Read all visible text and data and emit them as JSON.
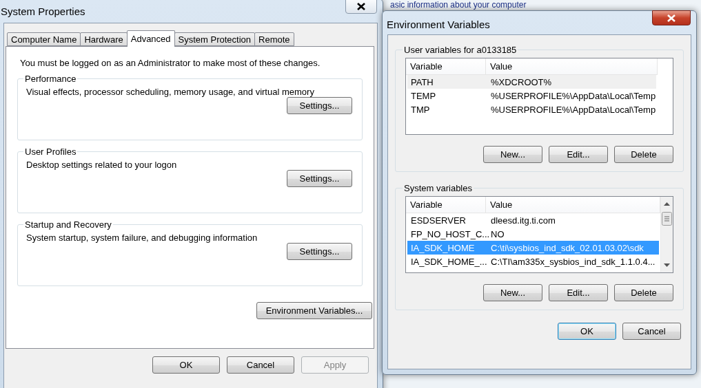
{
  "background": {
    "heading": "asic information about your computer"
  },
  "system_properties": {
    "title": "System Properties",
    "tabs": [
      {
        "label": "Computer Name",
        "selected": false
      },
      {
        "label": "Hardware",
        "selected": false
      },
      {
        "label": "Advanced",
        "selected": true
      },
      {
        "label": "System Protection",
        "selected": false
      },
      {
        "label": "Remote",
        "selected": false
      }
    ],
    "notice": "You must be logged on as an Administrator to make most of these changes.",
    "groups": [
      {
        "title": "Performance",
        "description": "Visual effects, processor scheduling, memory usage, and virtual memory",
        "button": "Settings..."
      },
      {
        "title": "User Profiles",
        "description": "Desktop settings related to your logon",
        "button": "Settings..."
      },
      {
        "title": "Startup and Recovery",
        "description": "System startup, system failure, and debugging information",
        "button": "Settings..."
      }
    ],
    "env_button": "Environment Variables...",
    "buttons": [
      {
        "label": "OK",
        "disabled": false
      },
      {
        "label": "Cancel",
        "disabled": false
      },
      {
        "label": "Apply",
        "disabled": true
      }
    ]
  },
  "environment_variables": {
    "title": "Environment Variables",
    "lists": [
      {
        "title": "User variables for a0133185",
        "focused": false,
        "columns": [
          "Variable",
          "Value"
        ],
        "rows": [
          {
            "variable": "PATH",
            "value": "%XDCROOT%",
            "selected": true
          },
          {
            "variable": "TEMP",
            "value": "%USERPROFILE%\\AppData\\Local\\Temp",
            "selected": false
          },
          {
            "variable": "TMP",
            "value": "%USERPROFILE%\\AppData\\Local\\Temp",
            "selected": false
          }
        ],
        "buttons": [
          "New...",
          "Edit...",
          "Delete"
        ]
      },
      {
        "title": "System variables",
        "focused": true,
        "columns": [
          "Variable",
          "Value"
        ],
        "rows": [
          {
            "variable": "ESDSERVER",
            "value": "dleesd.itg.ti.com",
            "selected": false
          },
          {
            "variable": "FP_NO_HOST_C...",
            "value": "NO",
            "selected": false
          },
          {
            "variable": "IA_SDK_HOME",
            "value": "C:\\ti\\sysbios_ind_sdk_02.01.03.02\\sdk",
            "selected": true
          },
          {
            "variable": "IA_SDK_HOME_...",
            "value": "C:\\TI\\am335x_sysbios_ind_sdk_1.1.0.4...",
            "selected": false
          }
        ],
        "buttons": [
          "New...",
          "Edit...",
          "Delete"
        ]
      }
    ],
    "buttons": [
      {
        "label": "OK",
        "default": true
      },
      {
        "label": "Cancel",
        "default": false
      }
    ]
  }
}
